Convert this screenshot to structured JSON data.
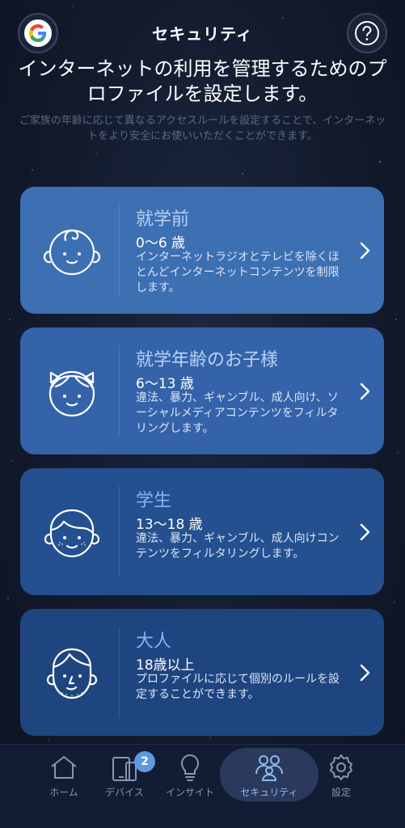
{
  "header": {
    "title": "セキュリティ",
    "google_icon": "google-logo",
    "help_icon": "help-icon"
  },
  "intro": {
    "headline": "インターネットの利用を管理するためのプロファイルを設定します。",
    "description": "ご家族の年齢に応じて異なるアクセスルールを設定することで、インターネットをより安全にお使いいただくことができます。"
  },
  "profiles": [
    {
      "name": "就学前",
      "age": "0〜6 歳",
      "description": "インターネットラジオとテレビを除くほとんどインターネットコンテンツを制限します。",
      "icon": "baby-face-icon"
    },
    {
      "name": "就学年齢のお子様",
      "age": "6〜13 歳",
      "description": "違法、暴力、ギャンブル、成人向け、ソーシャルメディアコンテンツをフィルタリングします。",
      "icon": "child-face-icon"
    },
    {
      "name": "学生",
      "age": "13〜18 歳",
      "description": "違法、暴力、ギャンブル、成人向けコンテンツをフィルタリングします。",
      "icon": "teen-face-icon"
    },
    {
      "name": "大人",
      "age": "18歳以上",
      "description": "プロファイルに応じて個別のルールを設定することができます。",
      "icon": "adult-face-icon"
    }
  ],
  "nav": {
    "home": "ホーム",
    "devices": "デバイス",
    "devices_badge": "2",
    "insights": "インサイト",
    "security": "セキュリティ",
    "settings": "設定"
  },
  "colors": {
    "accent": "#8fb8ee",
    "card_1": "#3d6fb3",
    "card_2": "#3563a9",
    "card_3": "#25508f",
    "card_4": "#1f4580",
    "badge": "#5a9ae0"
  }
}
